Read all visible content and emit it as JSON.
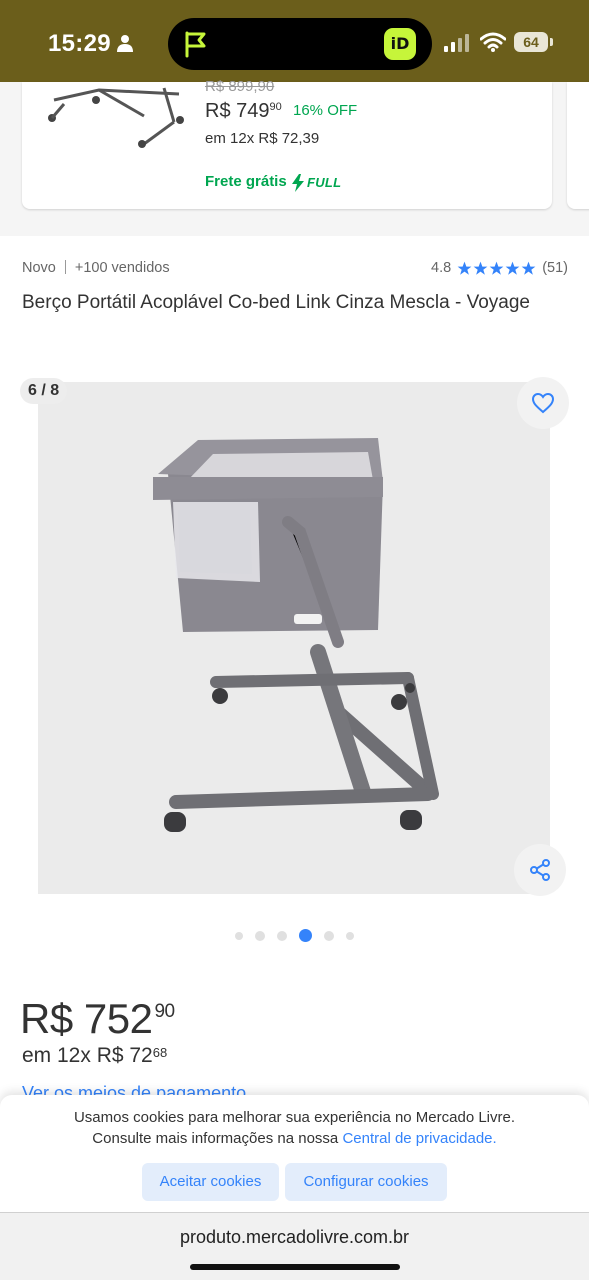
{
  "status_bar": {
    "time": "15:29",
    "battery": "64",
    "app_badge": "iD",
    "background_color": "#6b5e1b"
  },
  "recommended": {
    "old_price": "R$ 899,90",
    "price_int": "R$ 749",
    "price_cents": "90",
    "discount": "16% OFF",
    "installments": "em 12x R$ 72,39",
    "shipping": "Frete grátis",
    "full_label": "FULL"
  },
  "product": {
    "condition": "Novo",
    "sold": "+100 vendidos",
    "rating": "4.8",
    "rating_stars": 5,
    "reviews": "(51)",
    "title": "Berço Portátil Acoplável Co-bed Link Cinza Mescla - Voyage"
  },
  "gallery": {
    "counter": "6 / 8",
    "current_dot": 4,
    "visible_dots": 6
  },
  "pricing": {
    "price_int": "R$ 752",
    "price_cents": "90",
    "installments_prefix": "em 12x R$ 72",
    "installments_cents": "68",
    "payment_link": "Ver os meios de pagamento"
  },
  "cookies": {
    "line1": "Usamos cookies para melhorar sua experiência no Mercado Livre.",
    "line2_prefix": "Consulte mais informações na nossa",
    "link": "Central de privacidade.",
    "accept_label": "Aceitar cookies",
    "configure_label": "Configurar cookies"
  },
  "browser": {
    "url": "produto.mercadolivre.com.br"
  },
  "colors": {
    "accent_blue": "#3483fa",
    "green": "#00a650",
    "star": "#3483fa"
  }
}
